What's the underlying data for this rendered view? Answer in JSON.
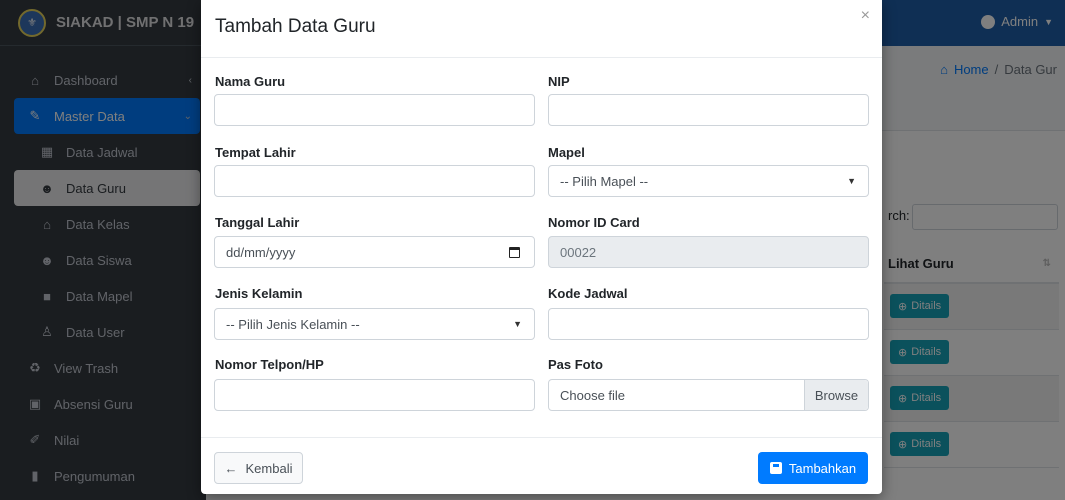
{
  "app": {
    "brand": "SIAKAD | SMP N 19",
    "user_label": "Admin"
  },
  "sidebar": {
    "items": [
      {
        "label": "Dashboard",
        "icon": "home-icon"
      },
      {
        "label": "Master Data",
        "icon": "edit-icon"
      },
      {
        "label": "Data Jadwal",
        "icon": "calendar-icon"
      },
      {
        "label": "Data Guru",
        "icon": "users-icon"
      },
      {
        "label": "Data Kelas",
        "icon": "home-icon"
      },
      {
        "label": "Data Siswa",
        "icon": "users-icon"
      },
      {
        "label": "Data Mapel",
        "icon": "book-icon"
      },
      {
        "label": "Data User",
        "icon": "user-plus-icon"
      },
      {
        "label": "View Trash",
        "icon": "recycle-icon"
      },
      {
        "label": "Absensi Guru",
        "icon": "calendar-check-icon"
      },
      {
        "label": "Nilai",
        "icon": "pen-icon"
      },
      {
        "label": "Pengumuman",
        "icon": "clipboard-icon"
      }
    ]
  },
  "breadcrumb": {
    "home": "Home",
    "separator": "/",
    "current": "Data Gur"
  },
  "table": {
    "search_label": "rch:",
    "column": "Lihat Guru",
    "button_label": "Ditails"
  },
  "modal": {
    "title": "Tambah Data Guru",
    "close": "×",
    "fields": {
      "nama_guru": {
        "label": "Nama Guru",
        "value": ""
      },
      "nip": {
        "label": "NIP",
        "value": ""
      },
      "tempat_lahir": {
        "label": "Tempat Lahir",
        "value": ""
      },
      "mapel": {
        "label": "Mapel",
        "value": "-- Pilih Mapel --"
      },
      "tanggal_lahir": {
        "label": "Tanggal Lahir",
        "value": "dd/mm/yyyy"
      },
      "nomor_id_card": {
        "label": "Nomor ID Card",
        "value": "00022"
      },
      "jenis_kelamin": {
        "label": "Jenis Kelamin",
        "value": "-- Pilih Jenis Kelamin --"
      },
      "kode_jadwal": {
        "label": "Kode Jadwal",
        "value": ""
      },
      "nomor_telpon": {
        "label": "Nomor Telpon/HP",
        "value": ""
      },
      "pas_foto": {
        "label": "Pas Foto",
        "value": "Choose file",
        "browse": "Browse"
      }
    },
    "back_button": "Kembali",
    "back_arrow": "←",
    "submit_button": "Tambahkan"
  }
}
